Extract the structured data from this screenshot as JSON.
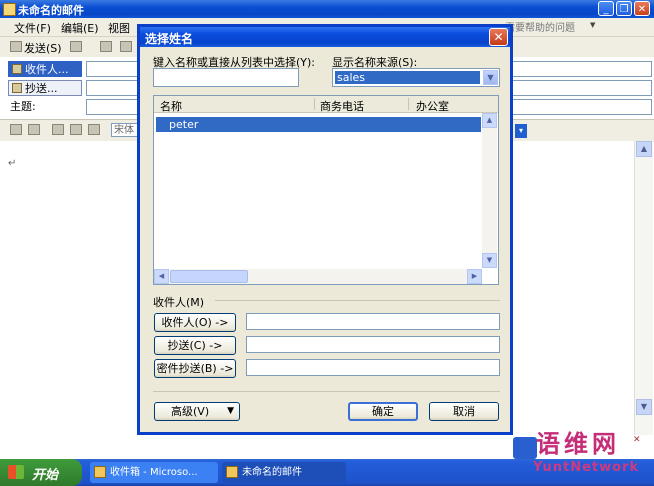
{
  "window": {
    "title": "未命名的邮件",
    "minimize": "_",
    "restore": "❐",
    "close": "✕"
  },
  "menubar": {
    "items": [
      "文件(F)",
      "编辑(E)",
      "视图"
    ],
    "help_placeholder": "需要帮助的问题"
  },
  "toolbar": {
    "send_label": "发送(S)"
  },
  "fields": {
    "to_label": "收件人...",
    "cc_label": "抄送...",
    "subject_label": "主题:"
  },
  "format": {
    "font_name": "宋体",
    "caret": "↵"
  },
  "dialog": {
    "title": "选择姓名",
    "close": "✕",
    "search_label": "键入名称或直接从列表中选择(Y):",
    "search_value": "",
    "source_label": "显示名称来源(S):",
    "source_value": "sales",
    "columns": [
      "名称",
      "商务电话",
      "办公室"
    ],
    "contacts": [
      "peter"
    ],
    "recipients_label": "收件人(M)",
    "to_button": "收件人(O) ->",
    "cc_button": "抄送(C) ->",
    "bcc_button": "密件抄送(B) ->",
    "to_value": "",
    "cc_value": "",
    "bcc_value": "",
    "advanced_button": "高级(V)",
    "ok_button": "确定",
    "cancel_button": "取消"
  },
  "taskbar": {
    "start": "开始",
    "tasks": [
      "收件箱 - Microso...",
      "未命名的邮件"
    ]
  },
  "watermark": {
    "line1": "语维网",
    "line2": "YuntNetwork"
  },
  "colors": {
    "titlebar": "#0a4fd4",
    "selection": "#316ac5",
    "taskbar": "#245edb",
    "start": "#3a8e36"
  }
}
